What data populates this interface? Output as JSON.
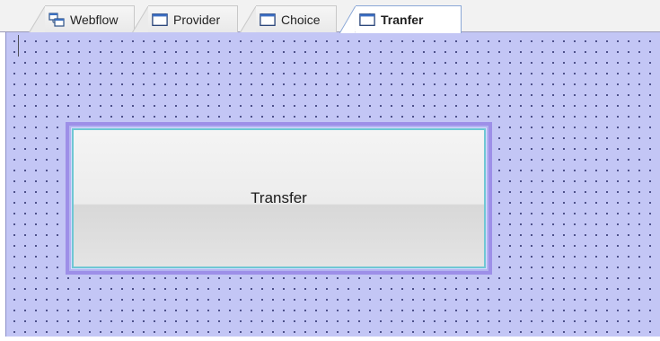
{
  "tabs": [
    {
      "label": "Webflow",
      "icon": "webflow-icon",
      "active": false
    },
    {
      "label": "Provider",
      "icon": "view-state-icon",
      "active": false
    },
    {
      "label": "Choice",
      "icon": "view-state-icon",
      "active": false
    },
    {
      "label": "Tranfer",
      "icon": "view-state-icon",
      "active": true
    }
  ],
  "canvas": {
    "node_label": "Transfer",
    "colors": {
      "background": "#c3c6f5",
      "grid_dot": "#3b3f7a",
      "selection_border": "#9d8fe8",
      "node_border": "#6fc7d4"
    }
  }
}
